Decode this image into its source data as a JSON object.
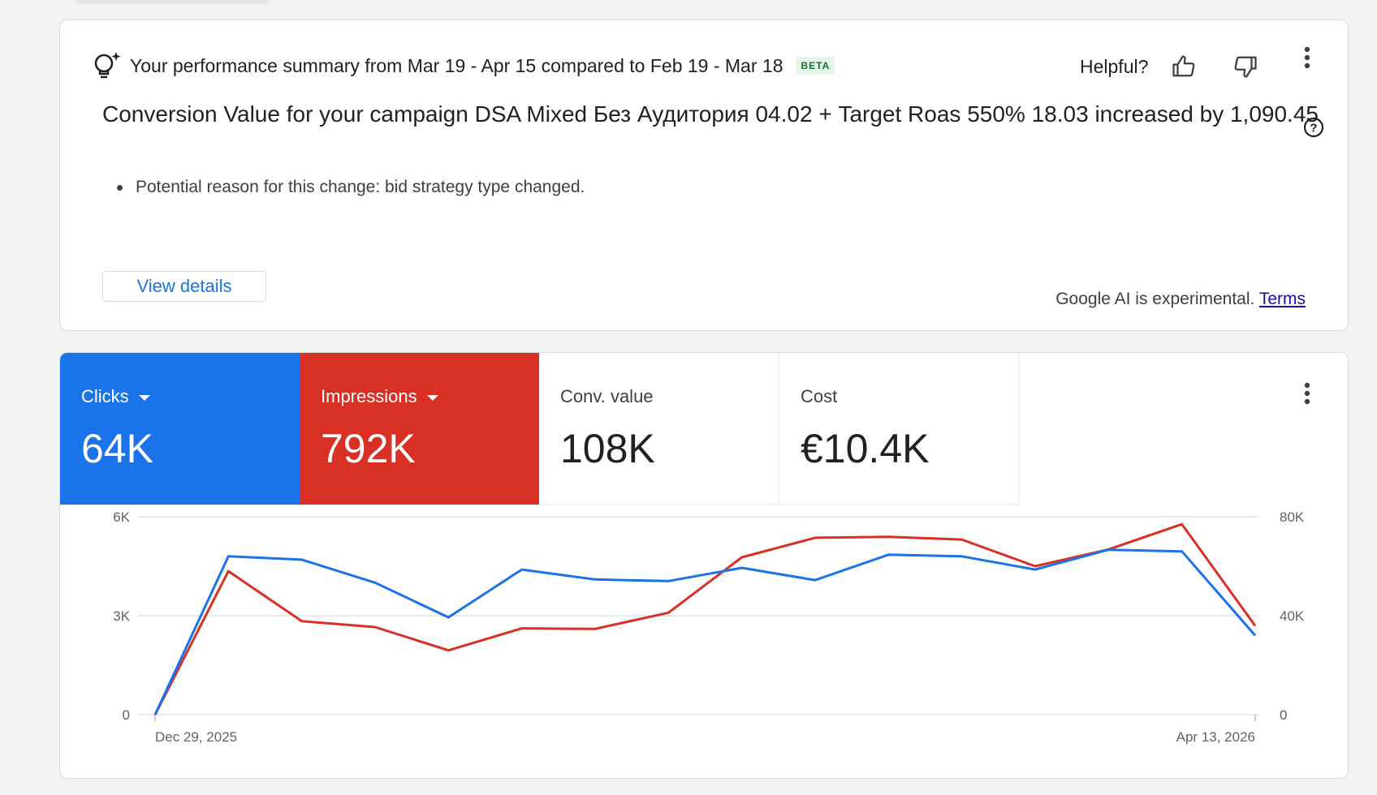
{
  "summary": {
    "title": "Your performance summary from Mar 19 - Apr 15 compared to Feb 19 - Mar 18",
    "beta_label": "BETA",
    "helpful_label": "Helpful?",
    "icons": {
      "bulb": "lightbulb-sparkle-icon",
      "thumbs_up": "thumbs-up-icon",
      "thumbs_down": "thumbs-down-icon",
      "more": "more-vert-icon",
      "help": "help-circle-icon"
    },
    "headline": "Conversion Value for your campaign DSA Mixed Без Аудитория 04.02 + Target Roas 550% 18.03 increased by 1,090.45",
    "reason": "Potential reason for this change: bid strategy type changed.",
    "view_details_label": "View details",
    "ai_note": "Google AI is experimental.",
    "terms_label": "Terms"
  },
  "metrics": [
    {
      "label": "Clicks",
      "value": "64K",
      "selected": true,
      "color": "#1a73e8"
    },
    {
      "label": "Impressions",
      "value": "792K",
      "selected": true,
      "color": "#d93025"
    },
    {
      "label": "Conv. value",
      "value": "108K",
      "selected": false
    },
    {
      "label": "Cost",
      "value": "€10.4K",
      "selected": false
    }
  ],
  "chart_data": {
    "type": "line",
    "x_start_label": "Dec 29, 2025",
    "x_end_label": "Apr 13, 2026",
    "y_left_ticks": [
      "0",
      "3K",
      "6K"
    ],
    "y_right_ticks": [
      "0",
      "40K",
      "80K"
    ],
    "ylim_left": [
      0,
      6000
    ],
    "ylim_right": [
      0,
      80000
    ],
    "grid": true,
    "series": [
      {
        "name": "Clicks",
        "axis": "left",
        "color": "#1a73e8",
        "values": [
          0,
          4800,
          4700,
          4000,
          2950,
          4400,
          4100,
          4050,
          4450,
          4080,
          4850,
          4800,
          4400,
          5000,
          4950,
          2400
        ]
      },
      {
        "name": "Impressions",
        "axis": "right",
        "color": "#d93025",
        "values": [
          0,
          58000,
          37800,
          35400,
          26000,
          34900,
          34700,
          41200,
          63600,
          71500,
          71900,
          70800,
          60000,
          66800,
          77000,
          35900
        ]
      }
    ]
  }
}
